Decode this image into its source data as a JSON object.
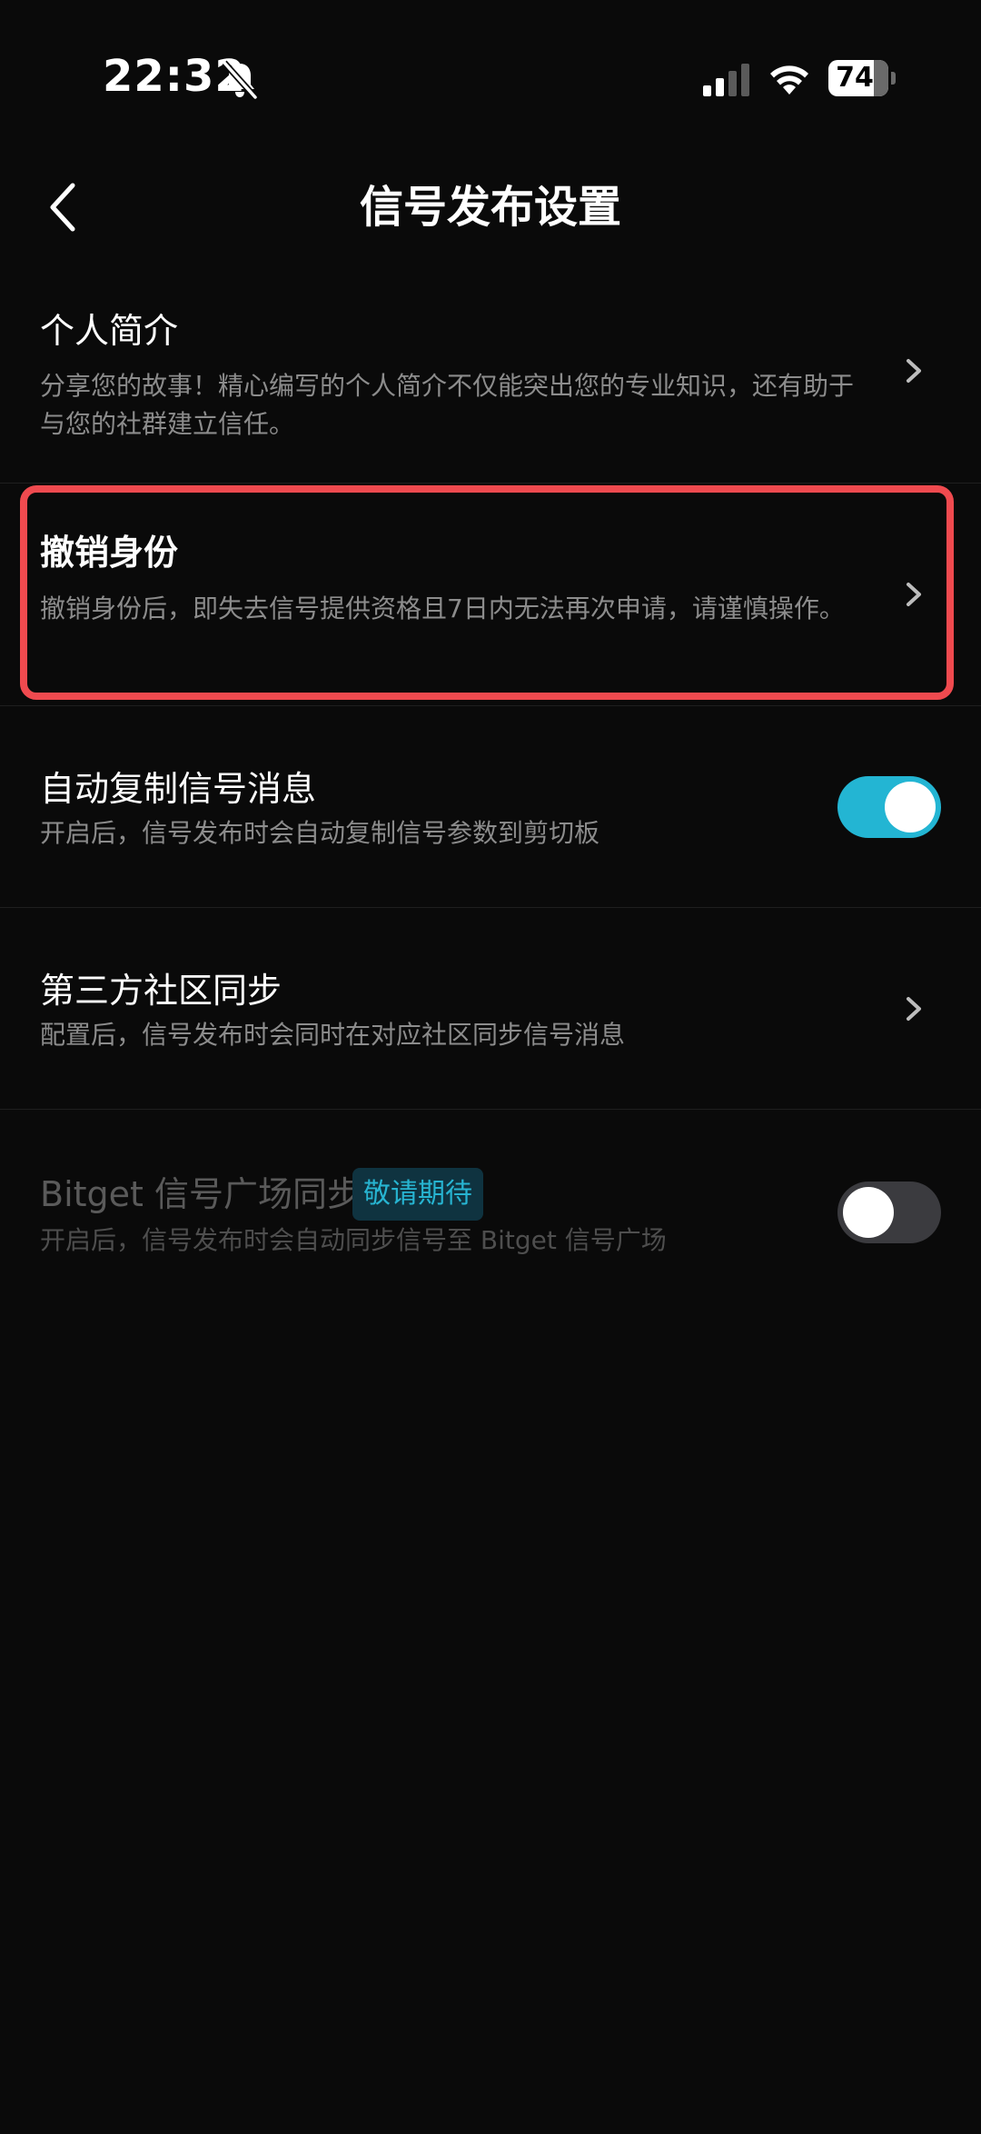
{
  "status_bar": {
    "time": "22:32",
    "battery": "74",
    "battery_level": 0.74
  },
  "header": {
    "title": "信号发布设置"
  },
  "settings": [
    {
      "title": "个人简介",
      "description": "分享您的故事！精心编写的个人简介不仅能突出您的专业知识，还有助于与您的社群建立信任。"
    },
    {
      "title": "撤销身份",
      "description": "撤销身份后，即失去信号提供资格且7日内无法再次申请，请谨慎操作。"
    },
    {
      "title": "自动复制信号消息",
      "description": "开启后，信号发布时会自动复制信号参数到剪切板",
      "toggle_on": true
    },
    {
      "title": "第三方社区同步",
      "description": "配置后，信号发布时会同时在对应社区同步信号消息"
    },
    {
      "title": "Bitget 信号广场同步",
      "badge": "敬请期待",
      "description": "开启后，信号发布时会自动同步信号至 Bitget 信号广场",
      "toggle_on": false
    }
  ],
  "colors": {
    "background": "#0a0a0a",
    "toggle_on": "#23b5d3",
    "toggle_off": "#3b3b3f",
    "highlight": "#f04a4f",
    "badge_bg": "#0f3340",
    "badge_text": "#27b4d1"
  },
  "icons": {
    "back": "chevron-left-icon",
    "chevron": "chevron-right-icon",
    "bell": "bell-slash-icon",
    "signal": "signal-icon",
    "wifi": "wifi-icon"
  }
}
